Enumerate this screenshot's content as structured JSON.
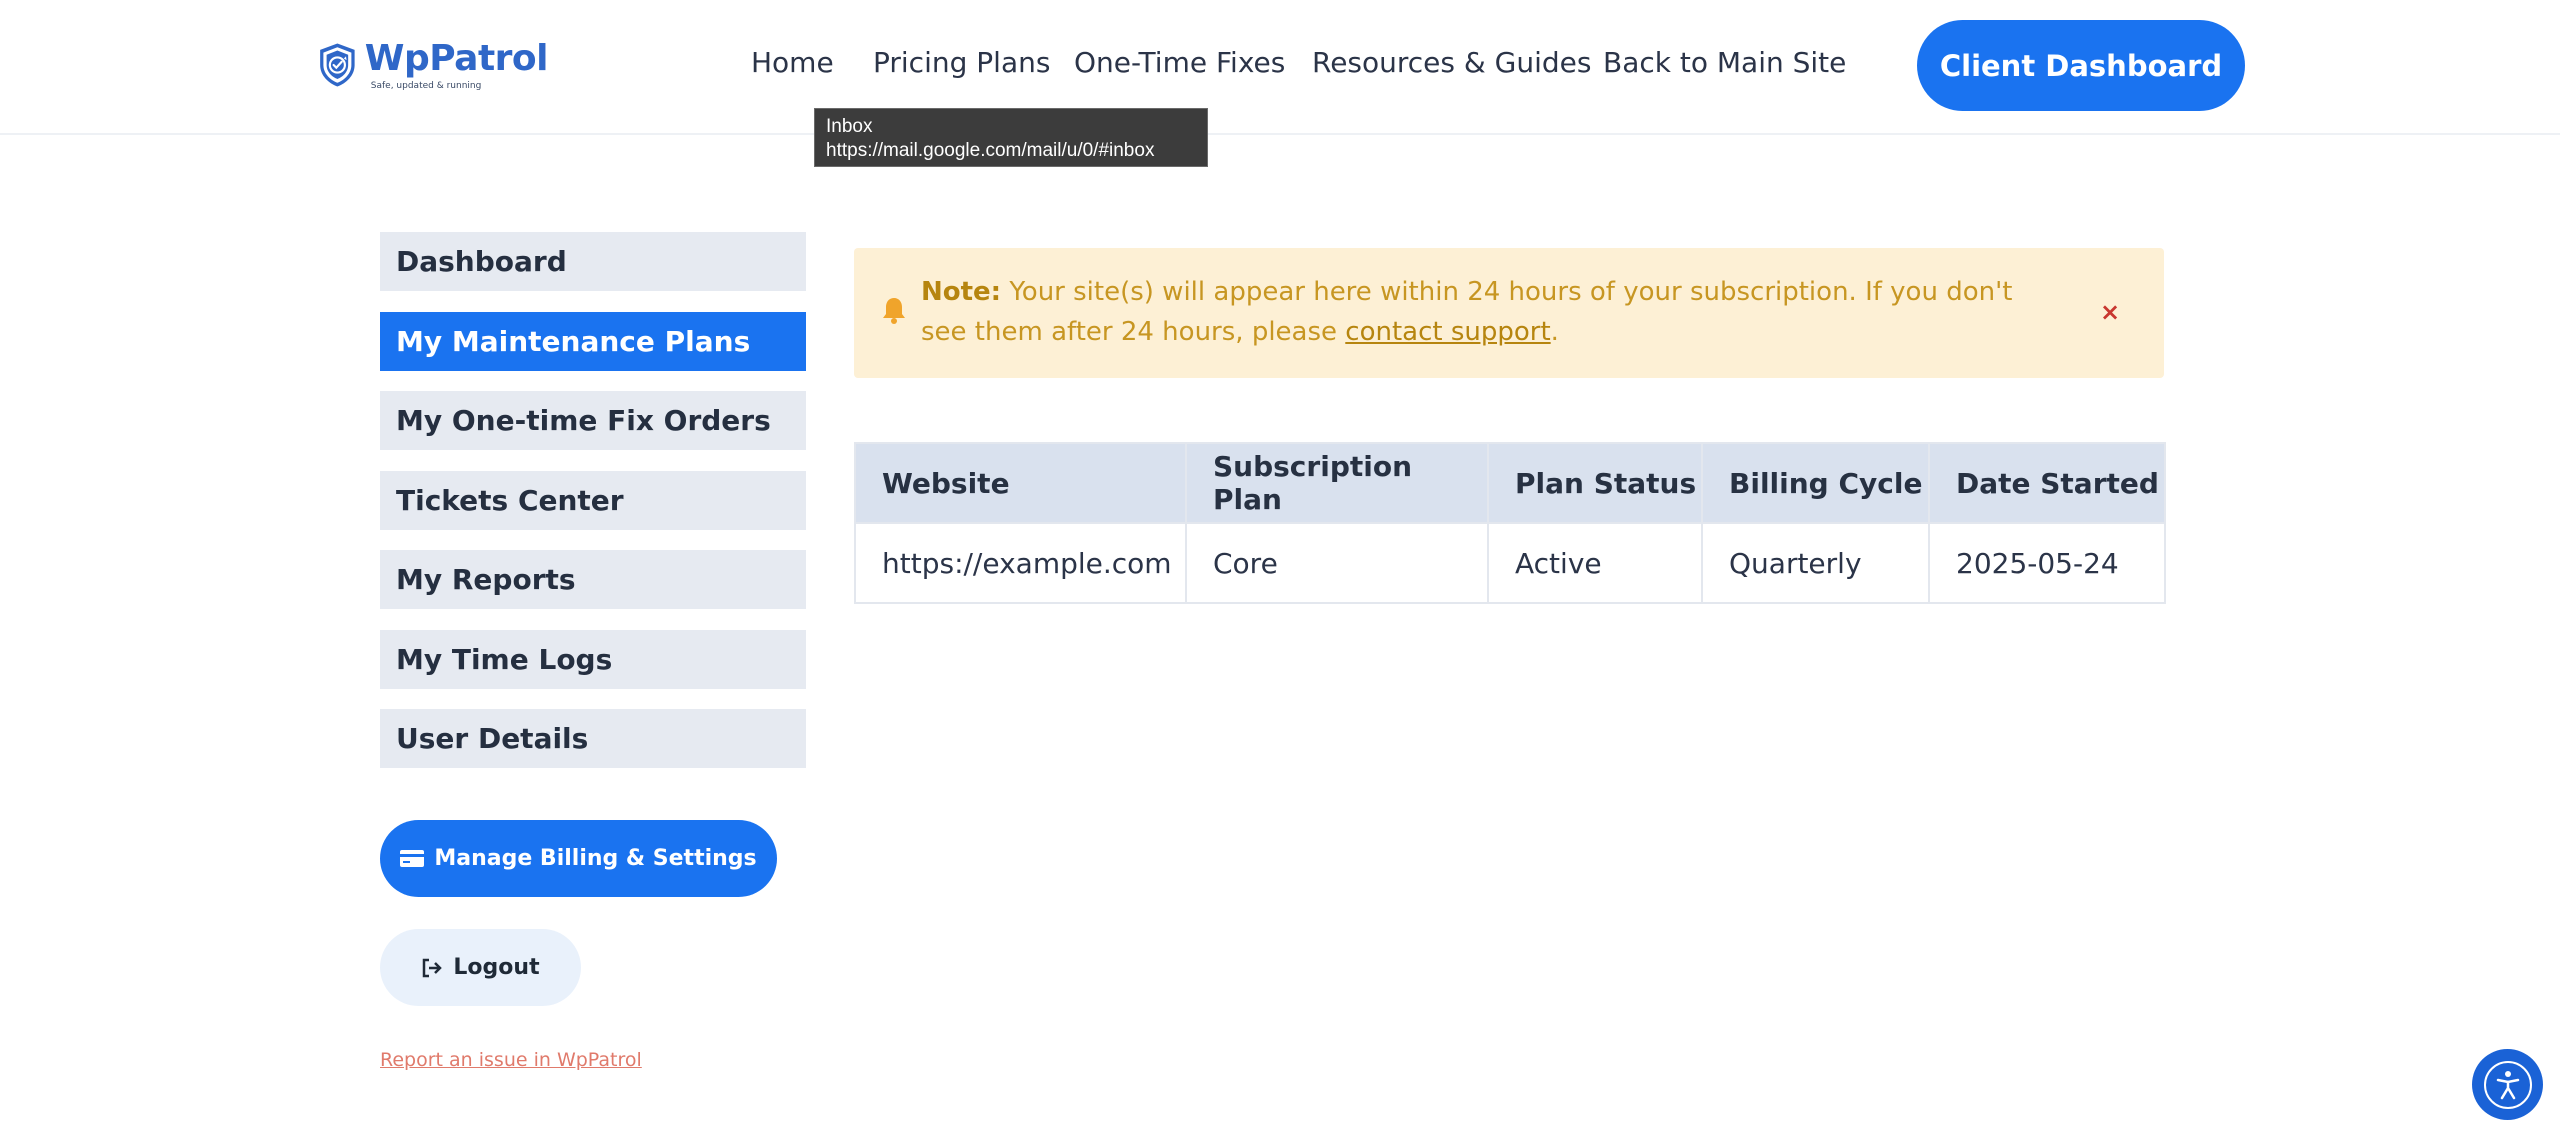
{
  "brand": {
    "name": "WpPatrol",
    "tagline": "Safe, updated & running"
  },
  "nav": {
    "items": [
      "Home",
      "Pricing Plans",
      "One-Time Fixes",
      "Resources & Guides",
      "Back to Main Site"
    ],
    "cta": "Client Dashboard"
  },
  "tooltip": {
    "title": "Inbox",
    "url": "https://mail.google.com/mail/u/0/#inbox"
  },
  "sidebar": {
    "items": [
      "Dashboard",
      "My Maintenance Plans",
      "My One-time Fix Orders",
      "Tickets Center",
      "My Reports",
      "My Time Logs",
      "User Details"
    ],
    "active_index": 1,
    "billing_button": "Manage Billing & Settings",
    "logout_button": "Logout",
    "report_link": "Report an issue in WpPatrol"
  },
  "note": {
    "label": "Note:",
    "text": "Your site(s) will appear here within 24 hours of your subscription. If you don't see them after 24 hours, please",
    "link": "contact support",
    "after": ".",
    "close": "×"
  },
  "table": {
    "headers": [
      "Website",
      "Subscription Plan",
      "Plan Status",
      "Billing Cycle",
      "Date Started"
    ],
    "rows": [
      [
        "https://example.com",
        "Core",
        "Active",
        "Quarterly",
        "2025-05-24"
      ]
    ]
  },
  "colors": {
    "primary": "#1a73f0",
    "note_bg": "#fdf0d5",
    "sidebar_bg": "#e6eaf1"
  }
}
